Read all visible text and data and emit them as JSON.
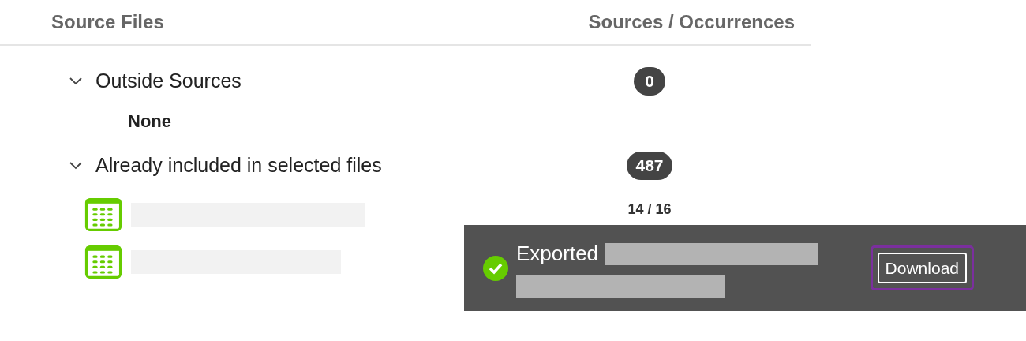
{
  "table": {
    "columns": [
      "Source Files",
      "Sources / Occurrences"
    ],
    "groups": [
      {
        "title": "Outside Sources",
        "expanded": true,
        "count": "0",
        "empty_text": "None"
      },
      {
        "title": "Already included in selected files",
        "expanded": true,
        "count": "487",
        "files": [
          {
            "kind": "spreadsheet",
            "occurrences": "14 / 16"
          },
          {
            "kind": "spreadsheet"
          }
        ]
      }
    ]
  },
  "toast": {
    "kind": "success",
    "message": "Exported",
    "button": "Download",
    "button_focused": true
  }
}
